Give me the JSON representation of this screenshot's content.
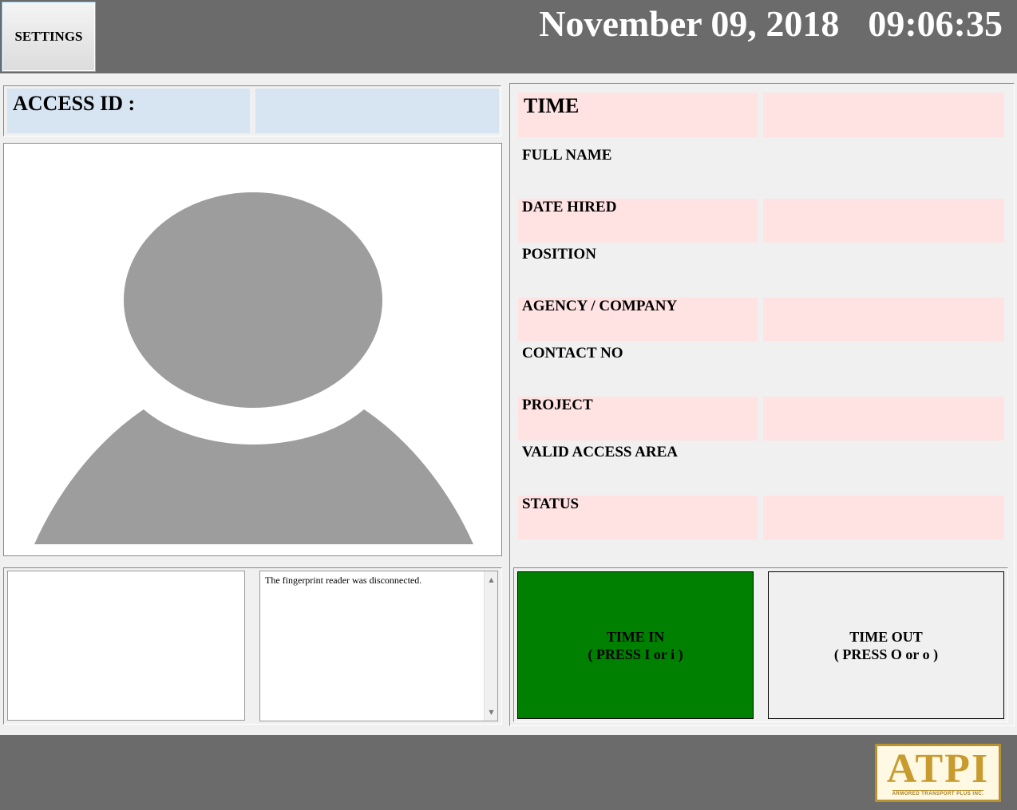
{
  "header": {
    "settings_label": "SETTINGS",
    "date": "November 09, 2018",
    "time": "09:06:35"
  },
  "access": {
    "label": "ACCESS ID :",
    "value": ""
  },
  "messages": {
    "left_text": "",
    "right_text": "The fingerprint reader was disconnected."
  },
  "fields": {
    "time": {
      "label": "TIME",
      "value": ""
    },
    "full_name": {
      "label": "FULL NAME",
      "value": ""
    },
    "date_hired": {
      "label": "DATE HIRED",
      "value": ""
    },
    "position": {
      "label": "POSITION",
      "value": ""
    },
    "agency": {
      "label": "AGENCY / COMPANY",
      "value": ""
    },
    "contact": {
      "label": "CONTACT NO",
      "value": ""
    },
    "project": {
      "label": "PROJECT",
      "value": ""
    },
    "valid_area": {
      "label": "VALID ACCESS AREA",
      "value": ""
    },
    "status": {
      "label": "STATUS",
      "value": ""
    }
  },
  "buttons": {
    "time_in_title": "TIME IN",
    "time_in_hint": "( PRESS I or i )",
    "time_out_title": "TIME OUT",
    "time_out_hint": "( PRESS O or o )"
  },
  "logo": {
    "text": "ATPI",
    "subtext": "ARMORED TRANSPORT PLUS INC."
  },
  "colors": {
    "header_bg": "#6b6b6b",
    "field_highlight": "#ffe3e3",
    "id_field": "#d7e4f2",
    "time_in_active": "#008000",
    "logo_gold": "#c79b2d"
  },
  "icons": {
    "photo": "user-avatar-placeholder-icon",
    "scroll_up": "scroll-up-arrow-icon",
    "scroll_down": "scroll-down-arrow-icon"
  }
}
